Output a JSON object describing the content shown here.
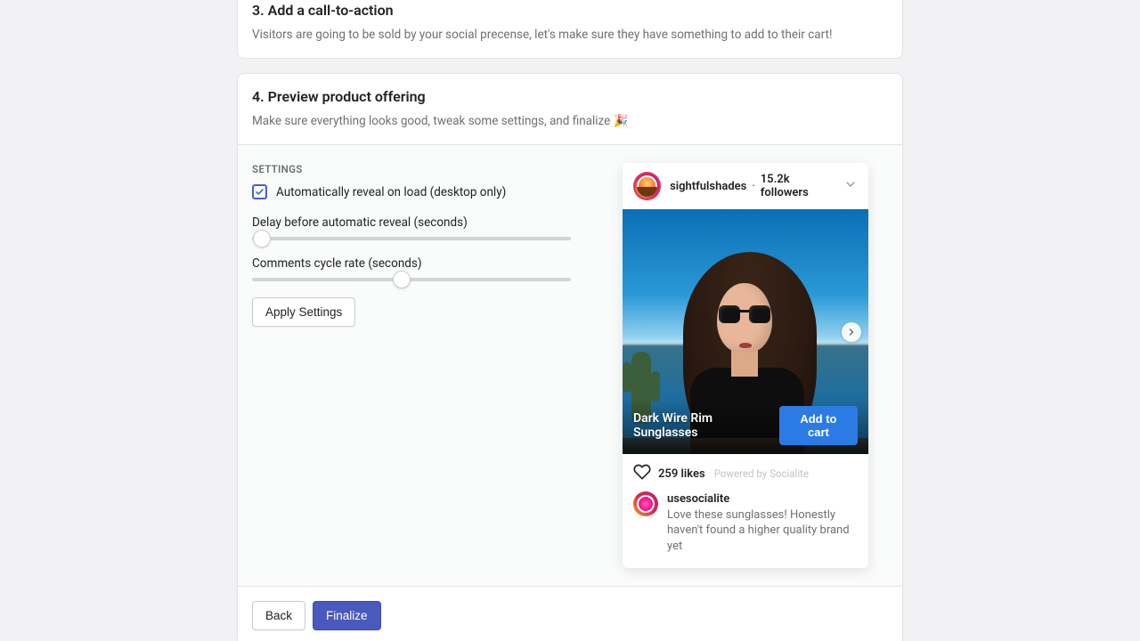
{
  "step3": {
    "title": "3. Add a call-to-action",
    "desc": "Visitors are going to be sold by your social precense, let's make sure they have something to add to their cart!"
  },
  "step4": {
    "title": "4. Preview product offering",
    "desc": "Make sure everything looks good, tweak some settings, and finalize 🎉"
  },
  "settings": {
    "heading": "SETTINGS",
    "auto_reveal_label": "Automatically reveal on load (desktop only)",
    "auto_reveal_checked": true,
    "delay_label": "Delay before automatic reveal (seconds)",
    "delay_value_pct": 3,
    "cycle_label": "Comments cycle rate (seconds)",
    "cycle_value_pct": 47,
    "apply_label": "Apply Settings"
  },
  "social": {
    "username": "sightfulshades",
    "sep": " · ",
    "followers": "15.2k followers",
    "product_name": "Dark Wire Rim Sunglasses",
    "add_to_cart": "Add to cart",
    "likes": "259 likes",
    "powered": "Powered by Socialite",
    "commenter": "usesocialite",
    "comment": "Love these sunglasses! Honestly haven't found a higher quality brand yet"
  },
  "footer": {
    "back": "Back",
    "finalize": "Finalize"
  }
}
